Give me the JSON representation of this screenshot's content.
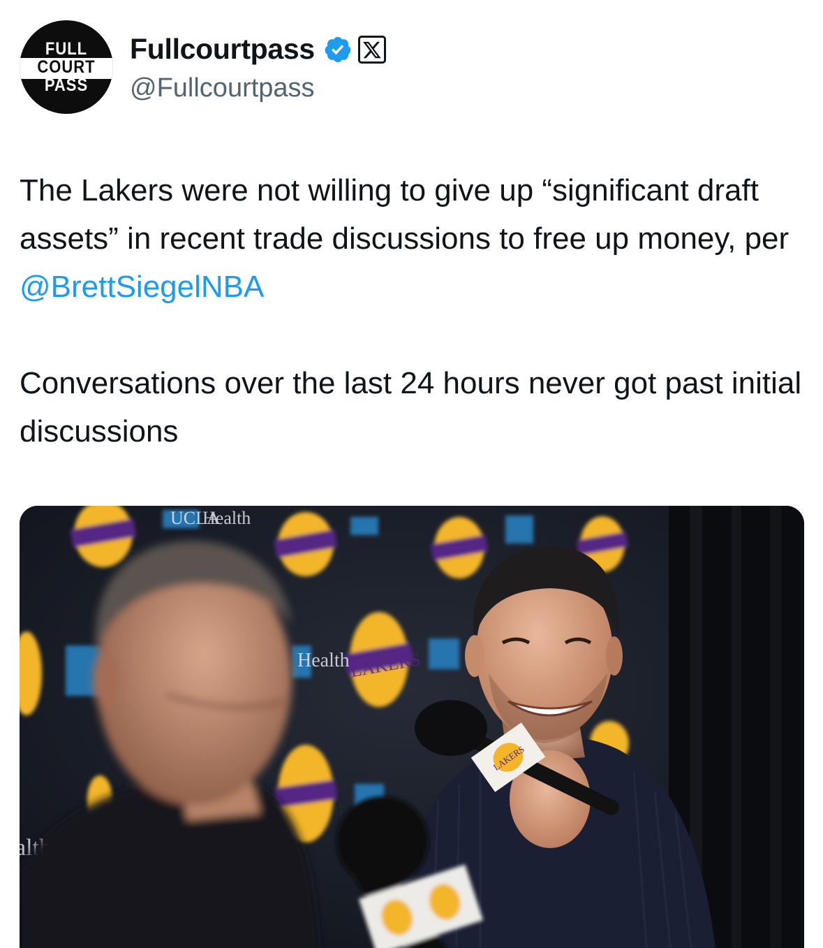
{
  "account": {
    "avatar_lines": [
      "FULL",
      "COURT",
      "PASS"
    ],
    "display_name": "Fullcourtpass",
    "handle": "@Fullcourtpass",
    "verified_icon": "verified-badge-icon",
    "platform_icon": "x-logo-icon"
  },
  "tweet": {
    "paragraph1_before": "The Lakers were not willing to give up “significant draft assets” in recent trade discussions to free up money, per ",
    "paragraph1_mention": "@BrettSiegelNBA",
    "paragraph2": "Conversations over the last 24 hours never got past initial discussions"
  },
  "media": {
    "backdrop_texts": [
      "LAKERS",
      "UCLA",
      "Health",
      "alth"
    ],
    "mic_flag_text": "LAKERS"
  },
  "colors": {
    "text": "#0f1419",
    "secondary": "#536471",
    "link": "#1d9bf0",
    "verified": "#1d9bf0",
    "lakers_gold": "#f3b62a",
    "lakers_purple": "#552583",
    "ucla_blue": "#2774ae"
  }
}
